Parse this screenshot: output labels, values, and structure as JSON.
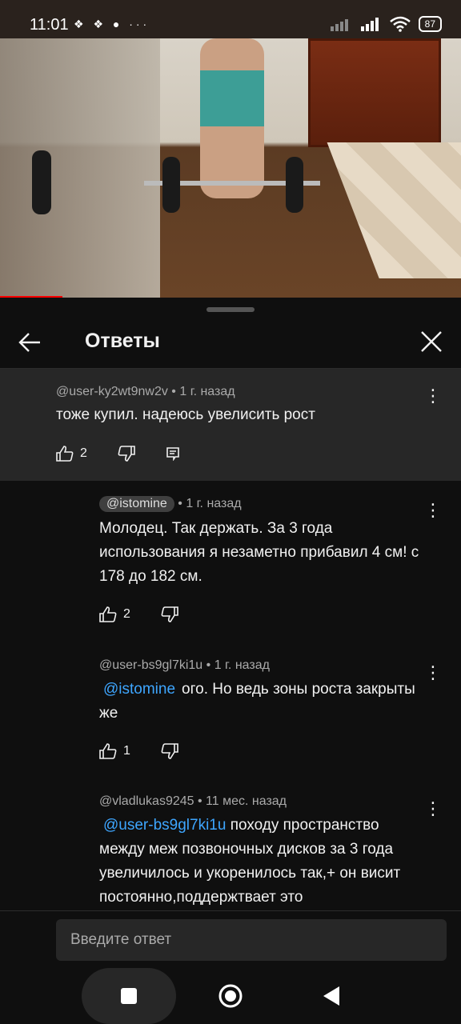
{
  "status": {
    "time": "11:01",
    "notif_icons": "❖ ❖ ●  ···",
    "battery": "87"
  },
  "header": {
    "title": "Ответы"
  },
  "parent_comment": {
    "author": "@user-ky2wt9nw2v",
    "time": "1 г. назад",
    "text": "тоже купил. надеюсь увелисить рост",
    "likes": "2"
  },
  "replies": [
    {
      "author": "@istomine",
      "time": "1 г. назад",
      "text": "Молодец. Так держать. За 3 года использования я незаметно прибавил 4 см! с 178 до 182 см.",
      "likes": "2"
    },
    {
      "author": "@user-bs9gl7ki1u",
      "time": "1 г. назад",
      "mention": "@istomine",
      "text": "ого. Но ведь зоны роста закрыты  же",
      "likes": "1"
    },
    {
      "author": "@vladlukas9245",
      "time": "11 мес. назад",
      "mention": "@user-bs9gl7ki1u",
      "text": "походу пространство между меж позвоночных дисков за 3 года увеличилось и укоренилось так,+ он висит постоянно,поддержтвает это"
    }
  ],
  "input": {
    "placeholder": "Введите ответ"
  },
  "icons": {
    "back": "arrow-left-icon",
    "close": "close-icon",
    "like": "thumb-up-icon",
    "dislike": "thumb-down-icon",
    "reply": "reply-icon",
    "more": "more-vert-icon"
  }
}
